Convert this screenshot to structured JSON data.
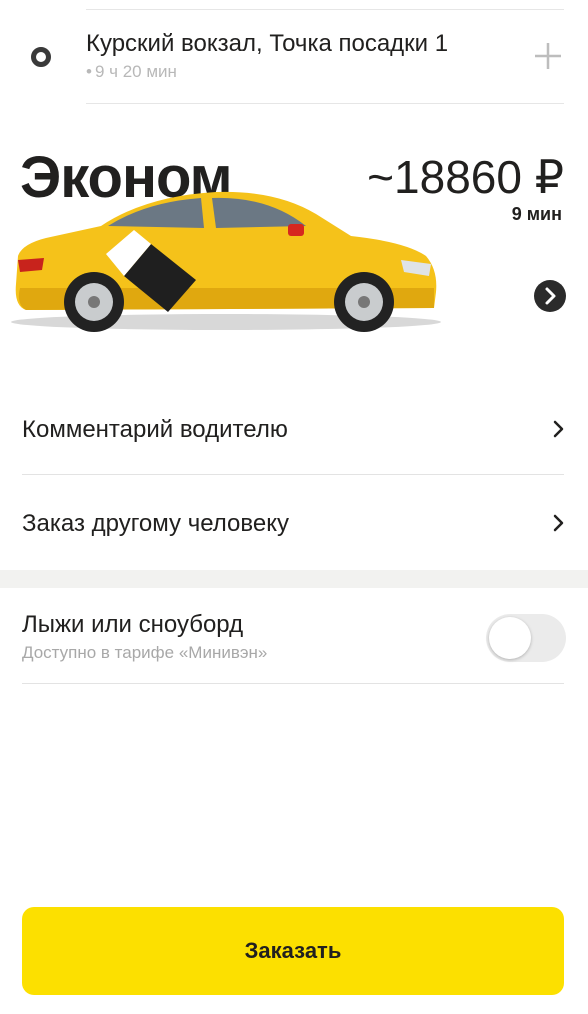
{
  "route": {
    "title": "Курский вокзал, Точка посадки 1",
    "subtitle": "9 ч 20 мин",
    "bullet": "•"
  },
  "tariff": {
    "name": "Эконом",
    "price": "~18860 ₽",
    "eta": "9 мин",
    "accent_color": "#fce000"
  },
  "options": {
    "driver_comment": "Комментарий водителю",
    "order_for_other": "Заказ другому человеку",
    "ski_title": "Лыжи или сноуборд",
    "ski_subtitle": "Доступно в тарифе «Минивэн»",
    "ski_enabled": false
  },
  "order_button": {
    "label": "Заказать",
    "color": "#fce000"
  }
}
